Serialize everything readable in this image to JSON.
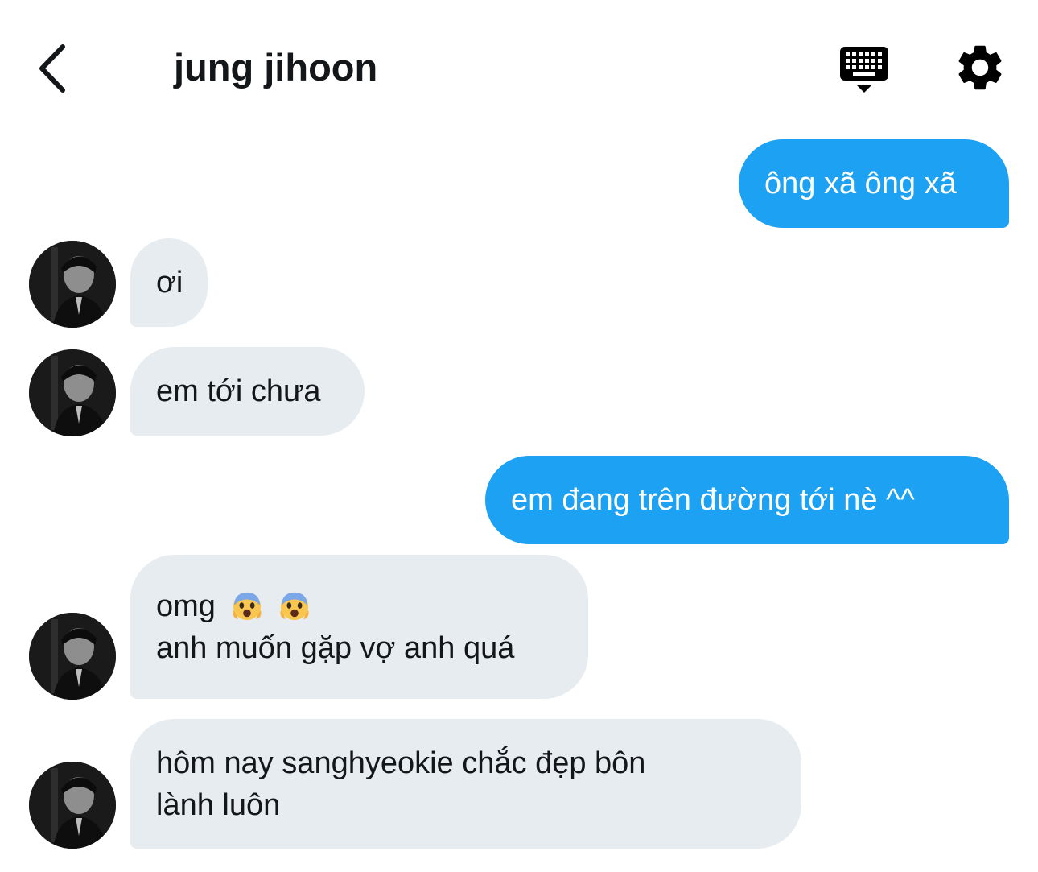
{
  "header": {
    "title": "jung jihoon",
    "back_icon": "chevron-left-icon",
    "keyboard_icon": "keyboard-icon",
    "settings_icon": "gear-icon"
  },
  "colors": {
    "outgoing_bubble": "#1da1f2",
    "incoming_bubble": "#e6ecf0",
    "text_dark": "#14171a"
  },
  "messages": [
    {
      "direction": "out",
      "text": "ông xã ông xã"
    },
    {
      "direction": "in",
      "text": "ơi"
    },
    {
      "direction": "in",
      "text": "em tới chưa"
    },
    {
      "direction": "out",
      "text": "em đang trên đường tới nè ^^"
    },
    {
      "direction": "in",
      "line1": "omg",
      "line1_emojis": [
        "fearful-face-emoji",
        "fearful-face-emoji"
      ],
      "line2": "anh muốn gặp vợ anh quá"
    },
    {
      "direction": "in",
      "text": "hôm nay sanghyeokie chắc đẹp bôn\nlành luôn"
    }
  ]
}
